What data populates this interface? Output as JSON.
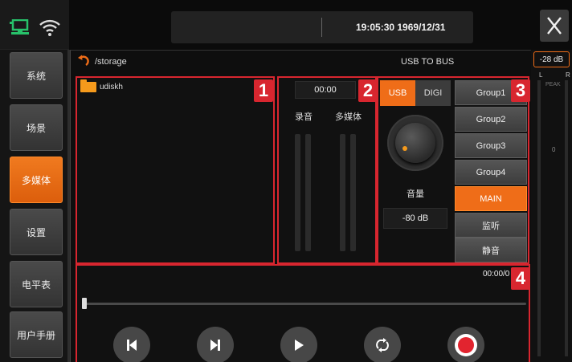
{
  "status": {
    "network_icon": "network-icon",
    "wifi_icon": "wifi-icon",
    "icon_color": "#27c26a"
  },
  "sidebar": {
    "items": [
      {
        "label": "系统",
        "active": false
      },
      {
        "label": "场景",
        "active": false
      },
      {
        "label": "多媒体",
        "active": true
      },
      {
        "label": "设置",
        "active": false
      },
      {
        "label": "电平表",
        "active": false
      },
      {
        "label": "用户手册",
        "active": false
      }
    ]
  },
  "topbar": {
    "datetime": "19:05:30 1969/12/31",
    "close_label": "X"
  },
  "browser": {
    "path": "/storage",
    "route": "USB TO BUS",
    "folder": "udiskh"
  },
  "recorder": {
    "time": "00:00",
    "record_label": "录音",
    "media_label": "多媒体"
  },
  "source": {
    "usb_label": "USB",
    "digi_label": "DIGI",
    "volume_label": "音量",
    "volume_value": "-80 dB",
    "groups": [
      "Group1",
      "Group2",
      "Group3",
      "Group4",
      "MAIN",
      "监听",
      "静音"
    ],
    "active_group": "MAIN"
  },
  "player": {
    "time": "00:00/0",
    "position": 0
  },
  "markers": [
    "1",
    "2",
    "3",
    "4"
  ],
  "meter": {
    "db": "-28 dB",
    "left": "L",
    "right": "R",
    "peak": "PEAK",
    "zero": "0"
  },
  "colors": {
    "accent": "#ef6d18",
    "marker": "#d8262f",
    "record": "#e2242f"
  }
}
